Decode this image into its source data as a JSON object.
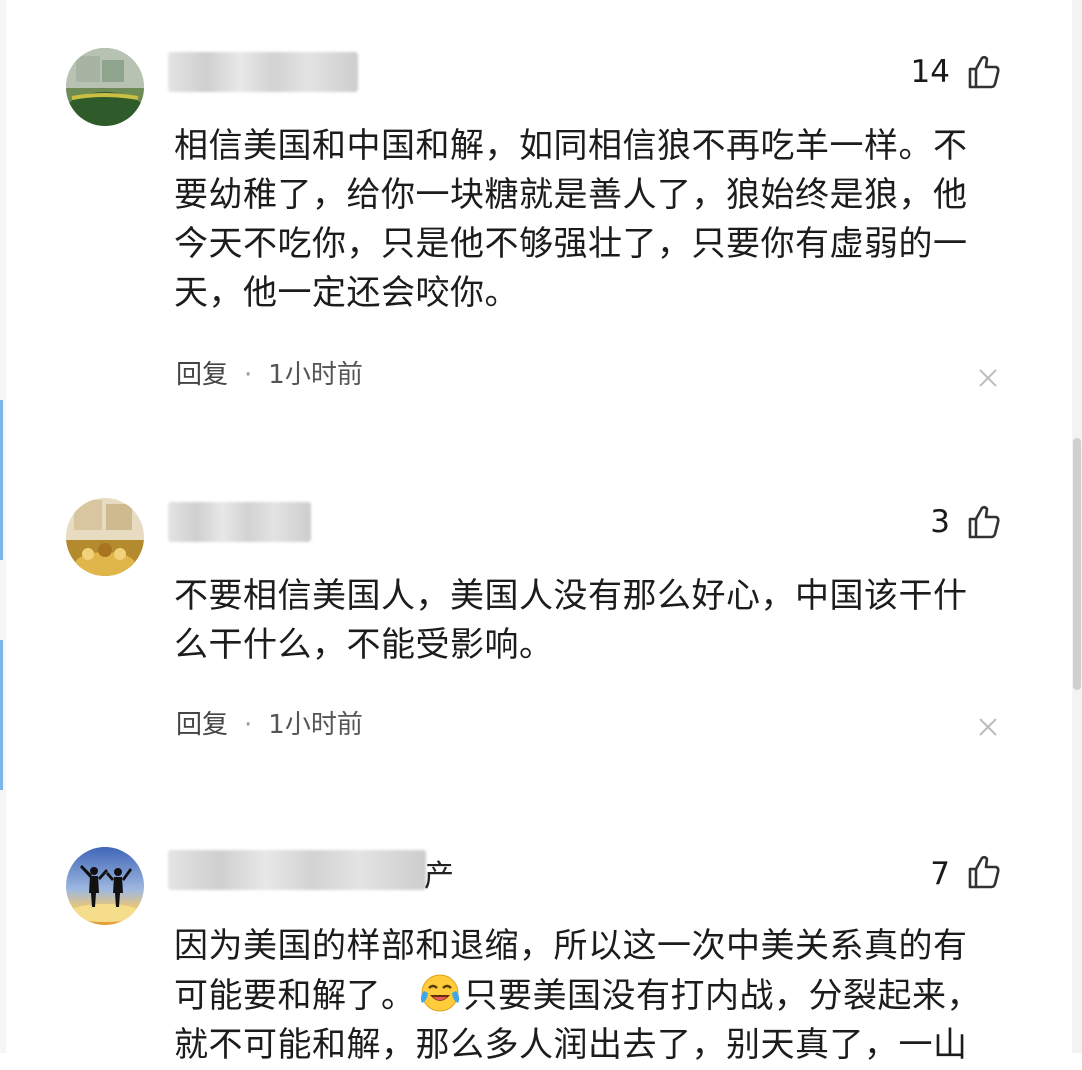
{
  "comments": [
    {
      "like_count": "14",
      "text": "相信美国和中国和解，如同相信狼不再吃羊一样。不要幼稚了，给你一块糖就是善人了，狼始终是狼，他今天不吃你，只是他不够强壮了，只要你有虚弱的一天，他一定还会咬你。",
      "reply_label": "回复",
      "separator": "·",
      "time": "1小时前"
    },
    {
      "like_count": "3",
      "text": "不要相信美国人，美国人没有那么好心，中国该干什么干什么，不能受影响。",
      "reply_label": "回复",
      "separator": "·",
      "time": "1小时前"
    },
    {
      "like_count": "7",
      "name_suffix": "产",
      "text_before_emoji": "因为美国的样部和退缩，所以这一次中美关系真的有可能要和解了。",
      "text_after_emoji": "只要美国没有打内战，分裂起来，就不可能和解，那么多人润出去了，别天真了，一山",
      "emoji": "crying-laughing-emoji"
    }
  ],
  "icons": {
    "like": "thumbs-up-icon",
    "close": "close-icon"
  },
  "colors": {
    "text": "#1c1c1c",
    "meta": "#555555",
    "icon": "#333333"
  }
}
